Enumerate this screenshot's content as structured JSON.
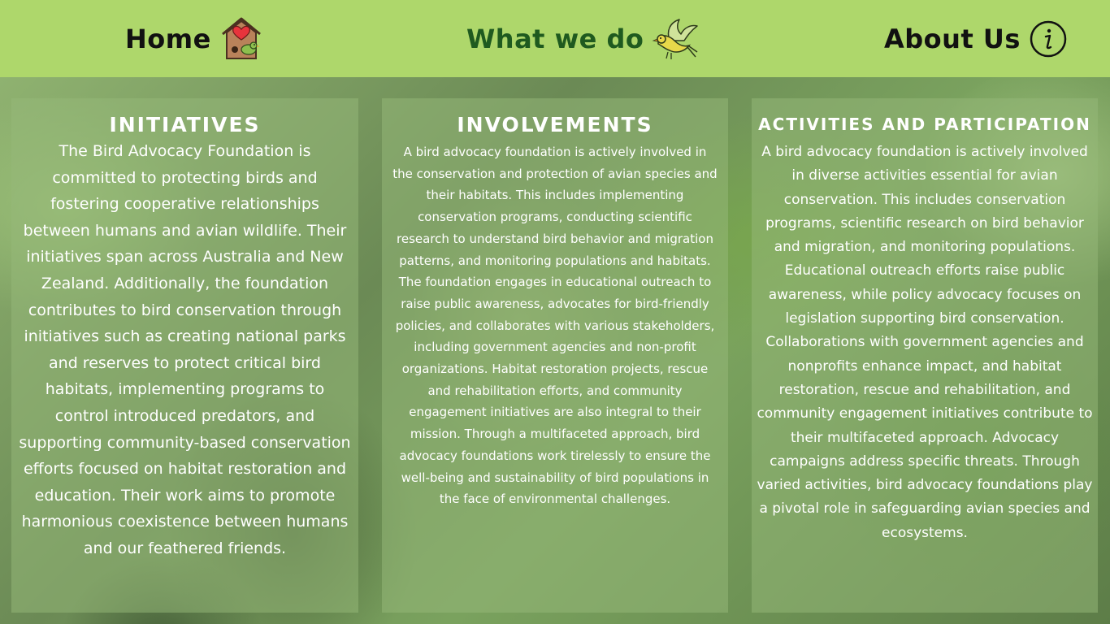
{
  "nav": {
    "home": {
      "label": "Home",
      "icon": "birdhouse-heart-icon"
    },
    "what_we_do": {
      "label": "What we do",
      "icon": "flying-bird-icon"
    },
    "about_us": {
      "label": "About Us",
      "icon": "info-icon"
    }
  },
  "colors": {
    "header_bg": "#aed76b",
    "active_nav": "#1f5a1f",
    "nav_text": "#111111",
    "panel_text": "#ffffff"
  },
  "panels": [
    {
      "title": "INITIATIVES",
      "text": "The Bird Advocacy Foundation is committed to protecting birds and fostering cooperative relationships between humans and avian wildlife. Their initiatives span across Australia and New Zealand. Additionally, the foundation contributes to bird conservation through initiatives such as creating national parks and reserves to protect critical bird habitats, implementing programs to control introduced predators, and supporting community-based conservation efforts focused on habitat restoration and education. Their work aims to promote harmonious coexistence between humans and our feathered friends."
    },
    {
      "title": "INVOLVEMENTS",
      "text": "A bird advocacy foundation is actively involved in the conservation and protection of avian species and their habitats. This includes implementing conservation programs, conducting scientific research to understand bird behavior and migration patterns, and monitoring populations and habitats. The foundation engages in educational outreach to raise public awareness, advocates for bird-friendly policies, and collaborates with various stakeholders, including government agencies and non-profit organizations. Habitat restoration projects, rescue and rehabilitation efforts, and community engagement initiatives are also integral to their mission. Through a multifaceted approach, bird advocacy foundations work tirelessly to ensure the well-being and sustainability of bird populations in the face of environmental challenges."
    },
    {
      "title": "ACTIVITIES AND PARTICIPATION",
      "text": "A bird advocacy foundation is actively involved in diverse activities essential for avian conservation. This includes conservation programs, scientific research on bird behavior and migration, and monitoring populations. Educational outreach efforts raise public awareness, while policy advocacy focuses on legislation supporting bird conservation. Collaborations with government agencies and nonprofits enhance impact, and habitat restoration, rescue and rehabilitation, and community engagement initiatives contribute to their multifaceted approach. Advocacy campaigns address specific threats. Through varied activities, bird advocacy foundations play a pivotal role in safeguarding avian species and ecosystems."
    }
  ]
}
